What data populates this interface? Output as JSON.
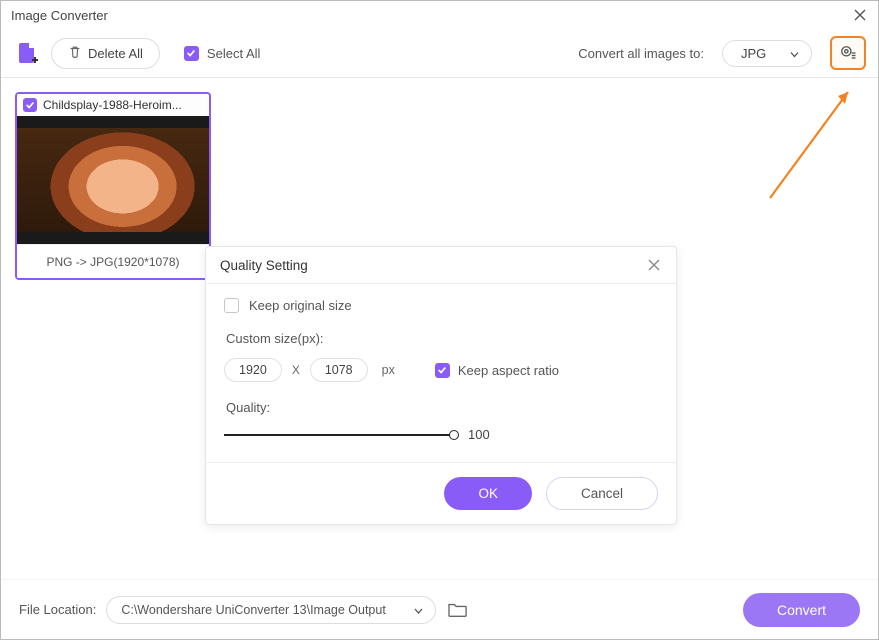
{
  "title": "Image Converter",
  "toolbar": {
    "delete_all": "Delete All",
    "select_all": "Select All",
    "convert_to_label": "Convert all images to:",
    "format_value": "JPG"
  },
  "thumbnail": {
    "filename": "Childsplay-1988-Heroim...",
    "conversion": "PNG -> JPG(1920*1078)"
  },
  "dialog": {
    "title": "Quality Setting",
    "keep_original": "Keep original size",
    "custom_size_label": "Custom size(px):",
    "width": "1920",
    "height": "1078",
    "x_sep": "X",
    "px": "px",
    "keep_ratio": "Keep aspect ratio",
    "quality_label": "Quality:",
    "quality_value": "100",
    "ok": "OK",
    "cancel": "Cancel"
  },
  "footer": {
    "label": "File Location:",
    "path": "C:\\Wondershare UniConverter 13\\Image Output",
    "convert": "Convert"
  }
}
